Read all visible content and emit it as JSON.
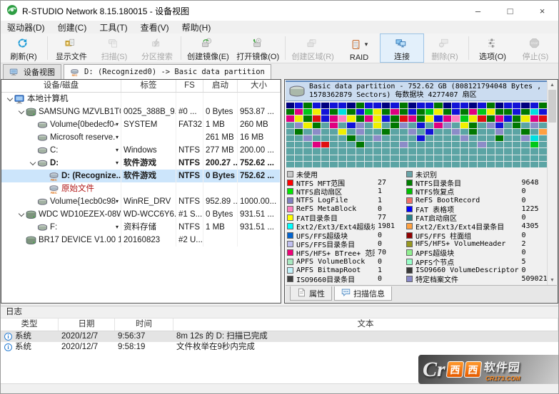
{
  "window": {
    "title": "R-STUDIO Network 8.15.180015 - 设备视图",
    "controls": {
      "minimize": "–",
      "maximize": "□",
      "close": "×"
    }
  },
  "menu": [
    "驱动器(D)",
    "创建(C)",
    "工具(T)",
    "查看(V)",
    "帮助(H)"
  ],
  "toolbar": [
    {
      "id": "refresh",
      "label": "刷新(R)",
      "enabled": true
    },
    {
      "sep": true
    },
    {
      "id": "show-files",
      "label": "显示文件",
      "enabled": true
    },
    {
      "id": "scan",
      "label": "扫描(S)",
      "enabled": false
    },
    {
      "id": "partition-search",
      "label": "分区搜索",
      "enabled": false
    },
    {
      "sep": true
    },
    {
      "id": "create-image",
      "label": "创建镜像(E)",
      "enabled": true
    },
    {
      "id": "open-image",
      "label": "打开镜像(O)",
      "enabled": true
    },
    {
      "sep": true
    },
    {
      "id": "create-region",
      "label": "创建区域(R)",
      "enabled": false
    },
    {
      "id": "raid",
      "label": "RAID",
      "enabled": true,
      "dropdown": true
    },
    {
      "id": "connect",
      "label": "连接",
      "enabled": true,
      "highlighted": true
    },
    {
      "id": "delete",
      "label": "删除(R)",
      "enabled": false
    },
    {
      "sep": true
    },
    {
      "id": "options",
      "label": "选项(O)",
      "enabled": true
    },
    {
      "id": "stop",
      "label": "停止(S)",
      "enabled": false
    }
  ],
  "tabs": [
    {
      "id": "device-view",
      "icon": "device-view",
      "label": "设备视图",
      "active": true
    },
    {
      "id": "recognized-partition",
      "icon": "rec",
      "label": "D: (Recognized0) -> Basic data partition",
      "active": false
    }
  ],
  "tree": {
    "columns": [
      "设备/磁盘",
      "标签",
      "FS",
      "启动",
      "大小"
    ],
    "rows": [
      {
        "level": 0,
        "expander": true,
        "icon": "computer",
        "name": "本地计算机",
        "label": "",
        "fs": "",
        "start": "",
        "size": ""
      },
      {
        "level": 1,
        "expander": true,
        "icon": "hdd",
        "name": "SAMSUNG MZVLB1T0...",
        "label": "0025_388B_9...",
        "fs": "#0 ...",
        "start": "0 Bytes",
        "size": "953.87 ..."
      },
      {
        "level": 2,
        "expander": false,
        "icon": "partition",
        "name": "Volume{0bedecf0-..",
        "dropdown": true,
        "label": "SYSTEM",
        "fs": "FAT32",
        "start": "1 MB",
        "size": "260 MB"
      },
      {
        "level": 2,
        "expander": false,
        "icon": "partition",
        "name": "Microsoft reserve..",
        "dropdown": true,
        "label": "",
        "fs": "",
        "start": "261 MB",
        "size": "16 MB"
      },
      {
        "level": 2,
        "expander": false,
        "icon": "partition",
        "name": "C:",
        "dropdown": true,
        "label": "Windows",
        "fs": "NTFS",
        "start": "277 MB",
        "size": "200.00 ..."
      },
      {
        "level": 2,
        "expander": true,
        "icon": "partition",
        "name": "D:",
        "bold": true,
        "dropdown": true,
        "label": "软件游戏",
        "fs": "NTFS",
        "start": "200.27 ...",
        "size": "752.62 ..."
      },
      {
        "level": 3,
        "expander": false,
        "icon": "rec",
        "name": "D: (Recognize...",
        "bold": true,
        "selected": true,
        "label": "软件游戏",
        "fs": "NTFS",
        "start": "0 Bytes",
        "size": "752.62 ..."
      },
      {
        "level": 3,
        "expander": false,
        "icon": "rec",
        "name": "原始文件",
        "red": true,
        "label": "",
        "fs": "",
        "start": "",
        "size": ""
      },
      {
        "level": 2,
        "expander": false,
        "icon": "partition",
        "name": "Volume{1ecb0c98-.",
        "dropdown": true,
        "label": "WinRE_DRV",
        "fs": "NTFS",
        "start": "952.89 ...",
        "size": "1000.00..."
      },
      {
        "level": 1,
        "expander": true,
        "icon": "hdd",
        "name": "WDC WD10EZEX-08W...",
        "label": "WD-WCC6Y6...",
        "fs": "#1 S...",
        "start": "0 Bytes",
        "size": "931.51 ..."
      },
      {
        "level": 2,
        "expander": false,
        "icon": "partition",
        "name": "F:",
        "dropdown": true,
        "label": "资料存储",
        "fs": "NTFS",
        "start": "1 MB",
        "size": "931.51 ..."
      },
      {
        "level": 1,
        "expander": false,
        "icon": "hdd",
        "name": "BR17 DEVICE V1.00 1....",
        "label": "20160823",
        "fs": "#2 U...",
        "start": "",
        "size": ""
      }
    ]
  },
  "scan": {
    "header": "Basic data partition - 752.62 GB (808121794048 Bytes , 1578362879 Sectors) 每数据块 4277407 扇区",
    "scrollbar": {
      "up": "▲",
      "down": "▼"
    },
    "grid": {
      "palette": {
        "T": "#5ba4a4",
        "L": "#8c8cc8",
        "B": "#1212d8",
        "N": "#000080",
        "G": "#007800",
        "g": "#00c818",
        "M": "#e00080",
        "R": "#e01010",
        "Y": "#f0f000",
        "C": "#00e0e0",
        "O": "#ffa040",
        "P": "#ff80c0",
        "E": "#90f090",
        "V": "#b8b8ec",
        "W": "#f0f0f0"
      },
      "rows": [
        "NBGBNBBNGBBNBGNBBGNBBNBGNBBNBG",
        "GMgYBGCGBgYGMGBGgYGBGMgYGGBGCB",
        "MYGRBMPYGMYBGRMGYBMPgYRGMBGYMR",
        "TLYGTMTBLTYTGLTBTMLTYGTLBTGTLT",
        "TGTLTTYTLTTGTTLTBTTLTGTTLTTGTO",
        "TTLTTTTGTTLTTTTBTTTTLTTTGTTLCT",
        "TTTMRTTTGTTTTLTTTTTTTTLTTTTTgT",
        "TTTTTTTTTTTTTTTTTTTTTTTTTTTTTT",
        "TTTTTTTTTTTTTTTTTTTTTTTTTTTTTT",
        "TTTTTTTTTTTTTTTTTTTTTTTTTTTTTT"
      ]
    },
    "legend_left": [
      {
        "color": "#c8c8c8",
        "label": "未使用",
        "count": ""
      },
      {
        "color": "#ff0000",
        "label": "NTFS MFT范围",
        "count": "27"
      },
      {
        "color": "#00e800",
        "label": "NTFS启动扇区",
        "count": "1"
      },
      {
        "color": "#8080c0",
        "label": "NTFS LogFile",
        "count": "1"
      },
      {
        "color": "#ff80c0",
        "label": "ReFS MetaBlock",
        "count": "0"
      },
      {
        "color": "#ffff00",
        "label": "FAT目录条目",
        "count": "77"
      },
      {
        "color": "#00ffff",
        "label": "Ext2/Ext3/Ext4超级块",
        "count": "1981"
      },
      {
        "color": "#0064d0",
        "label": "UFS/FFS超级块",
        "count": "0"
      },
      {
        "color": "#c0c0f0",
        "label": "UFS/FFS目录条目",
        "count": "0"
      },
      {
        "color": "#f00078",
        "label": "HFS/HFS+ BTree+ 范围",
        "count": "70"
      },
      {
        "color": "#a8e8c0",
        "label": "APFS VolumeBlock",
        "count": "0"
      },
      {
        "color": "#c0f0f8",
        "label": "APFS BitmapRoot",
        "count": "1"
      },
      {
        "color": "#404040",
        "label": "ISO9660目录条目",
        "count": "0"
      }
    ],
    "legend_right": [
      {
        "color": "#68a4a8",
        "label": "未识别",
        "count": ""
      },
      {
        "color": "#008000",
        "label": "NTFS目录条目",
        "count": "9648"
      },
      {
        "color": "#00c000",
        "label": "NTFS恢复点",
        "count": "0"
      },
      {
        "color": "#f07068",
        "label": "ReFS BootRecord",
        "count": "0"
      },
      {
        "color": "#0000ff",
        "label": "FAT 表格项",
        "count": "1225"
      },
      {
        "color": "#288088",
        "label": "FAT启动扇区",
        "count": "0"
      },
      {
        "color": "#ffa040",
        "label": "Ext2/Ext3/Ext4目录条目",
        "count": "4305"
      },
      {
        "color": "#900000",
        "label": "UFS/FFS 柱面组",
        "count": "0"
      },
      {
        "color": "#989820",
        "label": "HFS/HFS+ VolumeHeader",
        "count": "2"
      },
      {
        "color": "#90f090",
        "label": "APFS超级块",
        "count": "0"
      },
      {
        "color": "#98ffc8",
        "label": "APFS个节点",
        "count": "5"
      },
      {
        "color": "#383838",
        "label": "ISO9660 VolumeDescriptor",
        "count": "0"
      },
      {
        "color": "#8888c8",
        "label": "特定档案文件",
        "count": "509021"
      }
    ],
    "tabs": [
      {
        "id": "properties",
        "icon": "prop",
        "label": "属性",
        "active": false
      },
      {
        "id": "scan-info",
        "icon": "scaninfo",
        "label": "扫描信息",
        "active": true
      }
    ]
  },
  "log": {
    "title": "日志",
    "columns": [
      "类型",
      "日期",
      "时间",
      "文本"
    ],
    "rows": [
      {
        "type": "系统",
        "date": "2020/12/7",
        "time": "9:56:37",
        "text": "8m 12s 的 D: 扫描已完成",
        "selected": true
      },
      {
        "type": "系统",
        "date": "2020/12/7",
        "time": "9:58:19",
        "text": "文件枚举在9秒内完成",
        "selected": false
      }
    ]
  },
  "watermark": {
    "cr": "Cr",
    "boxes": [
      "西",
      "西"
    ],
    "name": "软件园",
    "site": "CR173.COM"
  }
}
